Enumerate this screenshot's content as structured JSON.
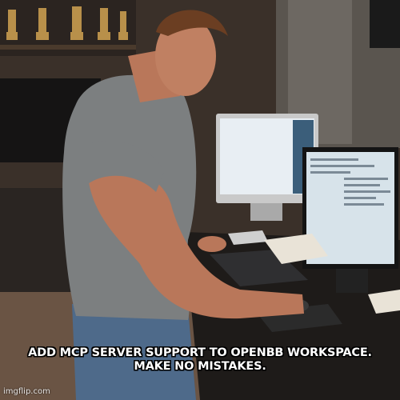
{
  "meme": {
    "caption_lines": [
      "ADD MCP SERVER SUPPORT TO OPENBB WORKSPACE.",
      "MAKE NO MISTAKES."
    ],
    "watermark": "imgflip.com"
  },
  "colors": {
    "caption_text": "#ffffff",
    "caption_outline": "#000000",
    "wall": "#3a3029",
    "desk": "#1e1b19",
    "shirt": "#7c7f80",
    "skin": "#b9775a"
  }
}
